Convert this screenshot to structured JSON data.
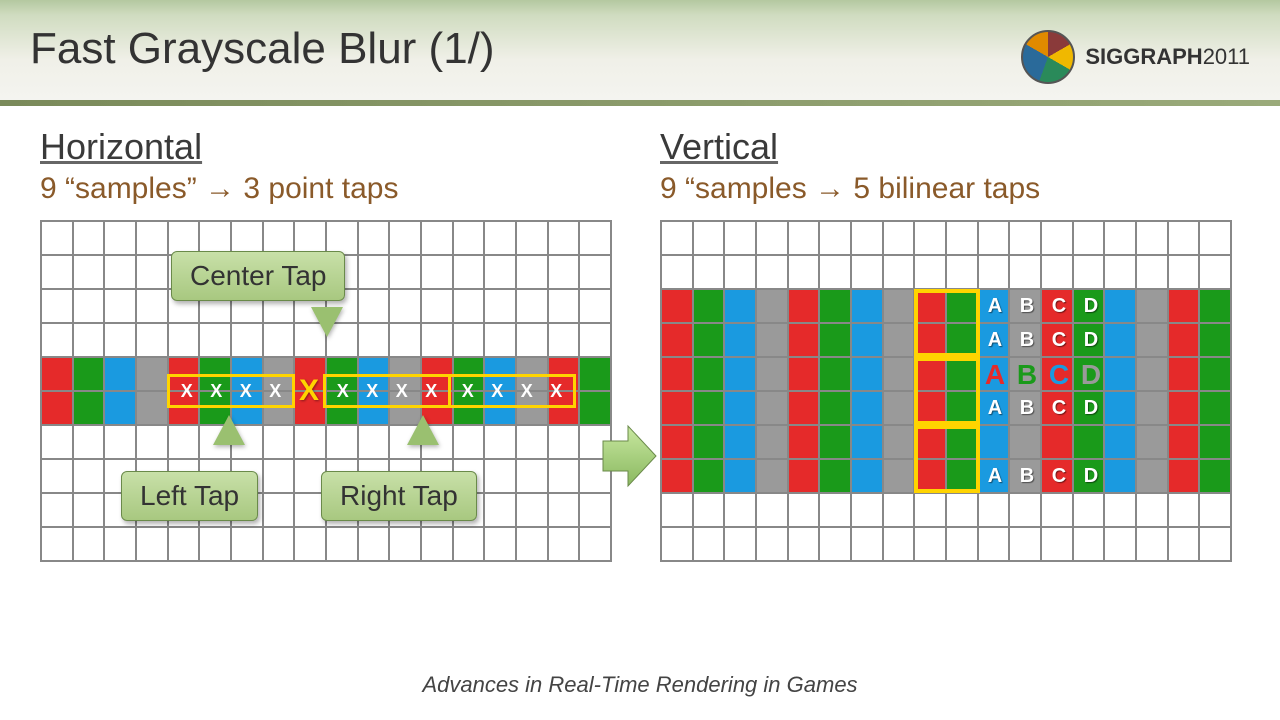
{
  "slide": {
    "title": "Fast Grayscale Blur (1/)",
    "logo": "SIGGRAPH",
    "logo_year": "2011",
    "footer": "Advances in Real-Time Rendering in Games"
  },
  "left": {
    "heading": "Horizontal",
    "subtext": "9 “samples” → 3 point taps",
    "callout_center": "Center Tap",
    "callout_left": "Left Tap",
    "callout_right": "Right Tap",
    "x_marks": [
      "X",
      "X",
      "X",
      "X",
      "X",
      "X",
      "X",
      "X",
      "X",
      "X",
      "X",
      "X",
      "X"
    ],
    "big_x": "X"
  },
  "right": {
    "heading": "Vertical",
    "subtext": "9 “samples → 5 bilinear taps",
    "labels": [
      "A",
      "B",
      "C",
      "D"
    ],
    "center_colors": [
      "#e52a2a",
      "#1a9a1a",
      "#1a9ae0",
      "#9a9a9a"
    ]
  },
  "colors": {
    "pattern": [
      "red",
      "green",
      "blue",
      "gray",
      "red",
      "green",
      "blue",
      "gray",
      "red",
      "green",
      "blue",
      "gray",
      "red",
      "green",
      "blue",
      "gray",
      "red",
      "green"
    ]
  }
}
